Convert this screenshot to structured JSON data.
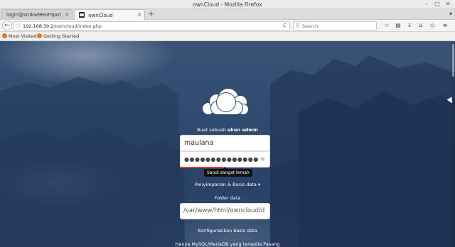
{
  "window": {
    "title": "ownCloud - Mozilla Firefox"
  },
  "window_controls": {
    "minimize": "–",
    "maximize": "□",
    "close": "✕"
  },
  "tabs": [
    {
      "label": "login@smkw9HotSpot",
      "close": "✕"
    },
    {
      "label": "ownCloud",
      "close": "✕"
    }
  ],
  "newtab": "+",
  "tabmenu": "▾",
  "nav": {
    "url_host": "192.168.30.2",
    "url_path": "/owncloud/index.php",
    "search_placeholder": "Search",
    "back": "←",
    "info": "ⓘ",
    "reload": "C",
    "search_glyph": "⚲",
    "toolbar_icons": [
      "☆",
      "▤",
      "↓",
      "⌂",
      "◇",
      "≡"
    ]
  },
  "bookmarks": [
    {
      "label": "Most Visited ▾",
      "color": "#e8772e"
    },
    {
      "label": "Getting Started",
      "color": "#e8772e"
    }
  ],
  "setup": {
    "create_prefix": "Buat sebuah ",
    "create_bold": "akun admin",
    "username_value": "maulana",
    "password_dots": "●●●●●●●●●●●●●●",
    "eye": "◉",
    "strength_tooltip": "Sandi sangat lemah",
    "storage_toggle": "Penyimpanan & Basis data ▾",
    "folder_label": "Folder data",
    "folder_value": "/var/www/html/owncloud/d",
    "db_label": "Konfigurasikan basis data",
    "db_note": "Hanya MySQL/MariaDB yang tersedia Pasang"
  },
  "colors": {
    "background": "#2f4a6f",
    "strength_bar": "#e53935"
  }
}
